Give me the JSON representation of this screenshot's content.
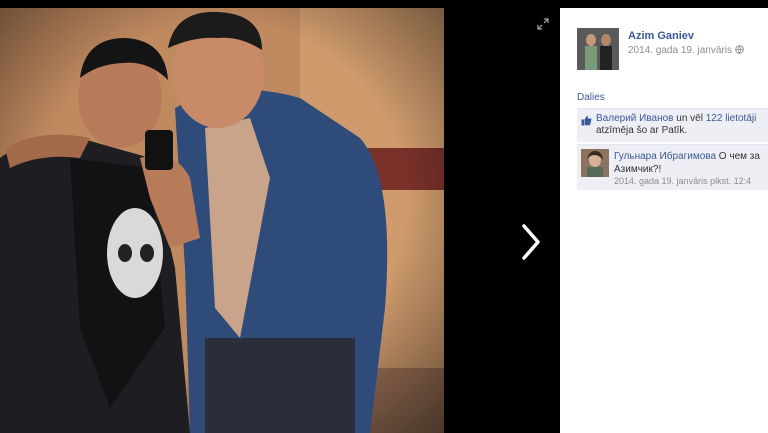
{
  "photo": {
    "alt": "",
    "next_arrow": "chevron-right-icon",
    "expand": "expand-icon"
  },
  "post": {
    "author": "Azim Ganiev",
    "date": "2014. gada 19. janvāris",
    "audience_icon": "globe-icon"
  },
  "actions": {
    "share": "Dalies"
  },
  "likes": {
    "first_name": "Валерий Иванов",
    "middle": " un vēl ",
    "others": "122 lietotāji",
    "line2": "atzīmēja šo ar Patīk."
  },
  "comment": {
    "author": "Гульнара Ибрагимова",
    "text": " О чем за",
    "line2": "Азимчик?!",
    "time": "2014. gada 19. janvāris plkst. 12:4"
  },
  "colors": {
    "link": "#3b5998",
    "meta": "#8d8d8d",
    "panel": "#edeff4"
  }
}
